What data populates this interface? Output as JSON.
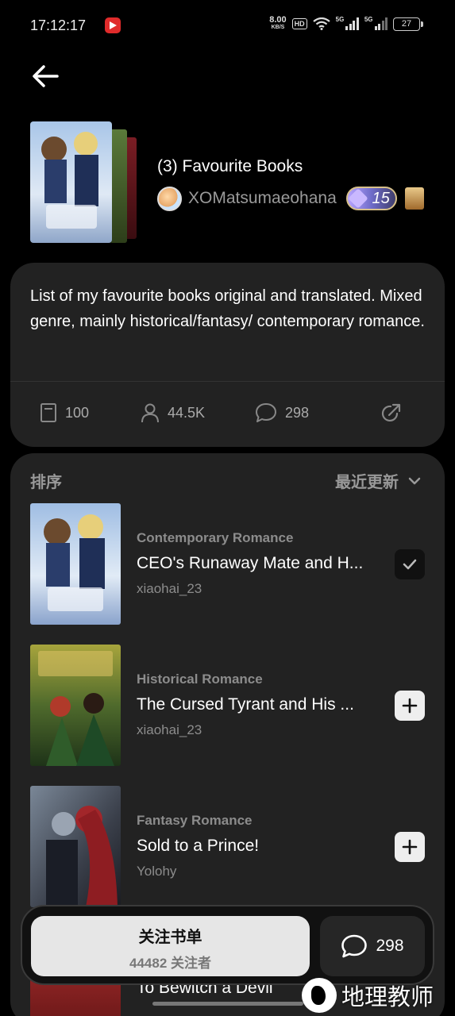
{
  "status_bar": {
    "time": "17:12:17",
    "net_speed": "8.00",
    "net_unit": "KB/S",
    "hd": "HD",
    "net1": "5G",
    "net2": "5G",
    "battery": "27"
  },
  "header": {
    "list_title": "(3) Favourite Books",
    "author": "XOMatsumaeohana",
    "level": "15"
  },
  "description": {
    "text": "List of my favourite books original and translated. Mixed genre, mainly historical/fantasy/ contemporary romance.",
    "stats": {
      "books": "100",
      "followers": "44.5K",
      "comments": "298"
    }
  },
  "sort": {
    "label": "排序",
    "value": "最近更新"
  },
  "books": [
    {
      "genre": "Contemporary Romance",
      "title": "CEO's Runaway Mate and H...",
      "author": "xiaohai_23",
      "added": true
    },
    {
      "genre": "Historical Romance",
      "title": "The Cursed Tyrant and His ...",
      "author": "xiaohai_23",
      "added": false
    },
    {
      "genre": "Fantasy Romance",
      "title": "Sold to a Prince!",
      "author": "Yolohy",
      "added": false
    },
    {
      "title": "To Bewitch a Devil"
    }
  ],
  "bottom": {
    "follow_label": "关注书单",
    "followers_count": "44482 关注者",
    "comment_count": "298"
  },
  "watermark": "地理教师",
  "colors": {
    "background": "#000000",
    "card": "#222222",
    "muted_text": "#8c8c8c",
    "follow_button": "#e6e6e6"
  }
}
